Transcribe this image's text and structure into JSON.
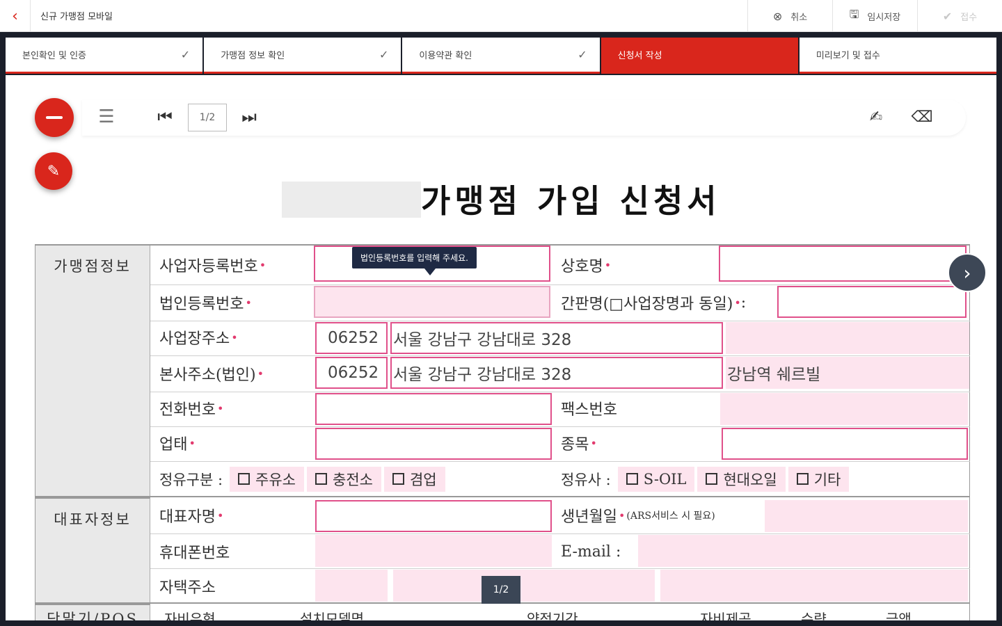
{
  "topbar": {
    "back_icon": "chevron-left-icon",
    "title": "신규 가맹점 모바일",
    "cancel_label": "취소",
    "save_label": "임시저장",
    "submit_label": "접수"
  },
  "steps": [
    {
      "label": "본인확인 및 인증",
      "done": true
    },
    {
      "label": "가맹점 정보 확인",
      "done": true
    },
    {
      "label": "이용약관 확인",
      "done": true
    },
    {
      "label": "신청서 작성",
      "active": true
    },
    {
      "label": "미리보기 및 접수"
    }
  ],
  "viewer": {
    "page_indicator": "1/2",
    "page_badge": "1/2"
  },
  "document": {
    "title": "가맹점 가입 신청서",
    "tooltip": "법인등록번호를 입력해 주세요."
  },
  "sections": {
    "merchant": "가맹점정보",
    "representative": "대표자정보",
    "terminal": "단말기/POS"
  },
  "fields": {
    "biz_reg_no": "사업자등록번호",
    "trade_name": "상호명",
    "corp_reg_no": "법인등록번호",
    "signboard": "간판명(□사업장명과 동일)",
    "signboard_suffix": ":",
    "biz_address": "사업장주소",
    "biz_zip": "06252",
    "biz_addr1": "서울 강남구 강남대로 328",
    "hq_address": "본사주소(법인)",
    "hq_zip": "06252",
    "hq_addr1": "서울 강남구 강남대로 328",
    "hq_addr2": "강남역 쉐르빌",
    "phone": "전화번호",
    "fax": "팩스번호",
    "biz_type": "업태",
    "biz_item": "종목",
    "fuel_type_label": "정유구분 :",
    "fuel_types": [
      "주유소",
      "충전소",
      "겸업"
    ],
    "refiner_label": "정유사 :",
    "refiners": [
      "S-OIL",
      "현대오일",
      "기타"
    ],
    "rep_name": "대표자명",
    "birth": "생년월일",
    "birth_note": "(ARS서비스 시 필요)",
    "mobile": "휴대폰번호",
    "email": "E-mail :",
    "home_address": "자택주소",
    "terminal_headers": [
      "자비유형",
      "설치모델명",
      "약정기간",
      "자비제공",
      "수량",
      "금액"
    ]
  },
  "colors": {
    "brand_red": "#d9261c",
    "field_pink": "#fde4ee",
    "field_border": "#e0508a"
  }
}
